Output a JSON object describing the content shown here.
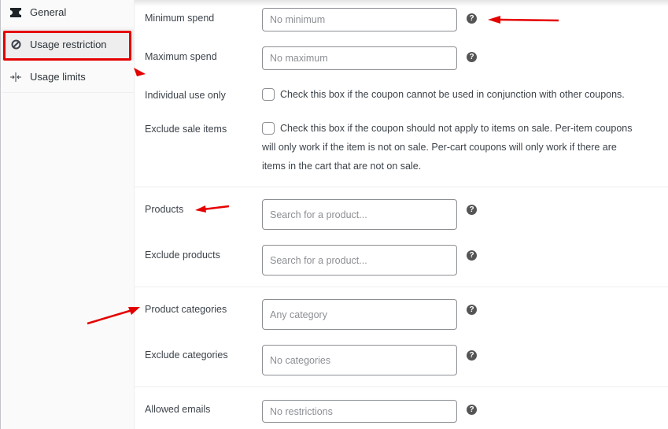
{
  "sidebar": {
    "tabs": [
      {
        "label": "General",
        "icon": "ticket-icon",
        "active": false
      },
      {
        "label": "Usage restriction",
        "icon": "prohibited-icon",
        "active": true
      },
      {
        "label": "Usage limits",
        "icon": "limits-icon",
        "active": false
      }
    ]
  },
  "form": {
    "minimum_spend": {
      "label": "Minimum spend",
      "placeholder": "No minimum",
      "value": ""
    },
    "maximum_spend": {
      "label": "Maximum spend",
      "placeholder": "No maximum",
      "value": ""
    },
    "individual_use": {
      "label": "Individual use only",
      "checked": false,
      "description": "Check this box if the coupon cannot be used in conjunction with other coupons."
    },
    "exclude_sale": {
      "label": "Exclude sale items",
      "checked": false,
      "description_line1": "Check this box if the coupon should not apply to items on sale. Per-item coupons",
      "description_line2": "will only work if the item is not on sale. Per-cart coupons will only work if there are",
      "description_line3": "items in the cart that are not on sale."
    },
    "products": {
      "label": "Products",
      "placeholder": "Search for a product..."
    },
    "exclude_products": {
      "label": "Exclude products",
      "placeholder": "Search for a product..."
    },
    "product_categories": {
      "label": "Product categories",
      "placeholder": "Any category"
    },
    "exclude_categories": {
      "label": "Exclude categories",
      "placeholder": "No categories"
    },
    "allowed_emails": {
      "label": "Allowed emails",
      "placeholder": "No restrictions"
    },
    "help_glyph": "?"
  },
  "annotations": {
    "highlight_color": "#e50000"
  }
}
